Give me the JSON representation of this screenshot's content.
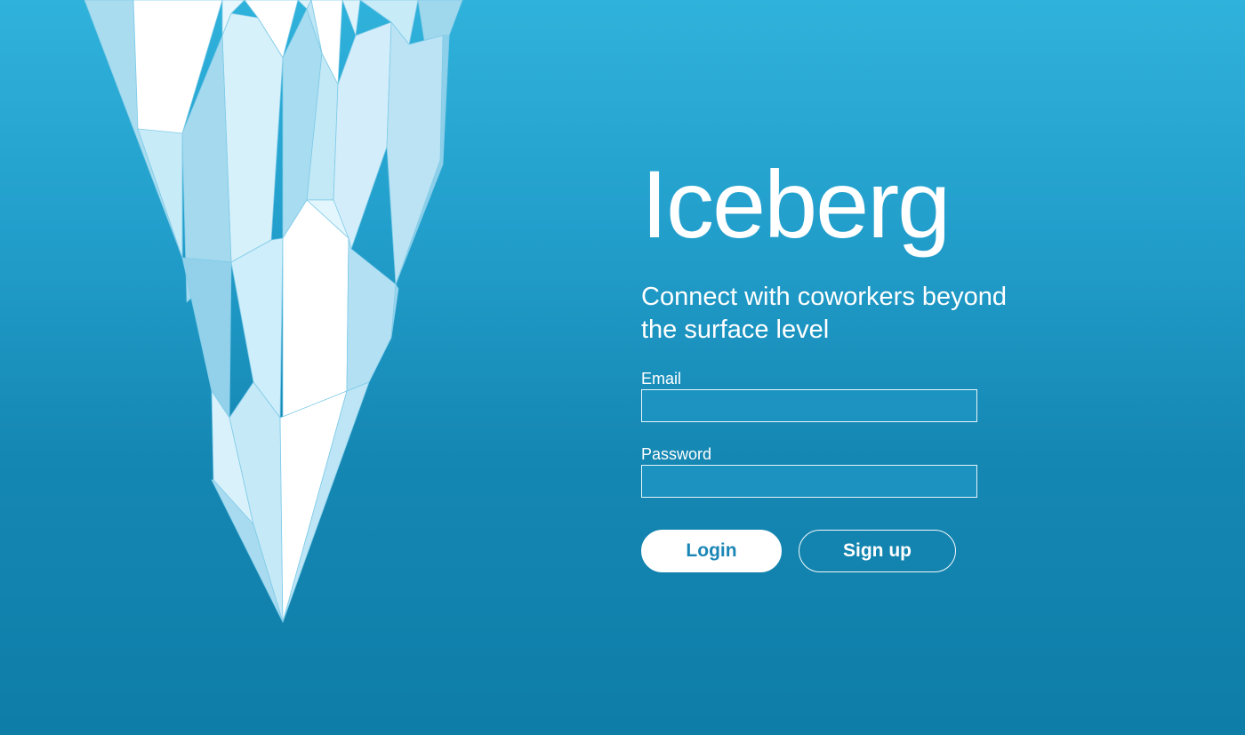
{
  "app": {
    "title": "Iceberg",
    "tagline": "Connect with coworkers beyond the surface level"
  },
  "form": {
    "email": {
      "label": "Email",
      "value": "",
      "placeholder": ""
    },
    "password": {
      "label": "Password",
      "value": "",
      "placeholder": ""
    }
  },
  "actions": {
    "login_label": "Login",
    "signup_label": "Sign up"
  },
  "colors": {
    "background_top": "#2fb2db",
    "background_bottom": "#0e7ea8",
    "accent_text": "#1b86b5",
    "ice_light": "#ffffff",
    "ice_mid": "#d4f0fb",
    "ice_shadow": "#8fd4ef"
  },
  "icons": {
    "iceberg_illustration": "iceberg-illustration"
  }
}
